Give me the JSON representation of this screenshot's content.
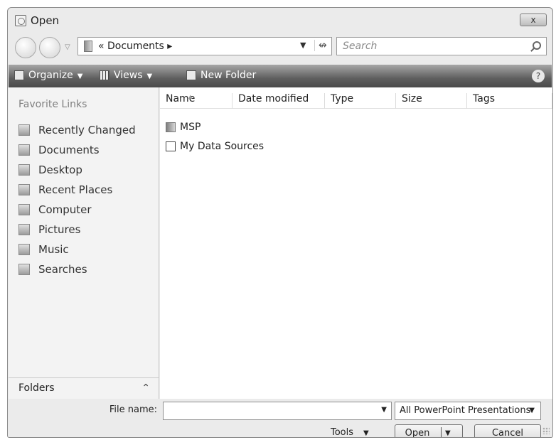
{
  "window": {
    "title": "Open",
    "close_symbol": "x"
  },
  "nav": {
    "address_path": "« Documents ▸",
    "search_placeholder": "Search"
  },
  "toolbar": {
    "organize": "Organize",
    "views": "Views",
    "new_folder": "New Folder",
    "help": "?"
  },
  "sidebar": {
    "heading": "Favorite Links",
    "items": [
      {
        "label": "Recently Changed",
        "icon": "recently-changed-icon"
      },
      {
        "label": "Documents",
        "icon": "documents-icon"
      },
      {
        "label": "Desktop",
        "icon": "desktop-icon"
      },
      {
        "label": "Recent Places",
        "icon": "recent-places-icon"
      },
      {
        "label": "Computer",
        "icon": "computer-icon"
      },
      {
        "label": "Pictures",
        "icon": "pictures-icon"
      },
      {
        "label": "Music",
        "icon": "music-icon"
      },
      {
        "label": "Searches",
        "icon": "searches-icon"
      }
    ],
    "folders_label": "Folders"
  },
  "columns": [
    "Name",
    "Date modified",
    "Type",
    "Size",
    "Tags"
  ],
  "files": [
    {
      "name": "MSP",
      "icon": "folder-icon"
    },
    {
      "name": "My Data Sources",
      "icon": "data-source-icon"
    }
  ],
  "bottom": {
    "file_name_label": "File name:",
    "file_name_value": "",
    "filter": "All PowerPoint Presentations",
    "tools": "Tools",
    "open": "Open",
    "cancel": "Cancel"
  }
}
